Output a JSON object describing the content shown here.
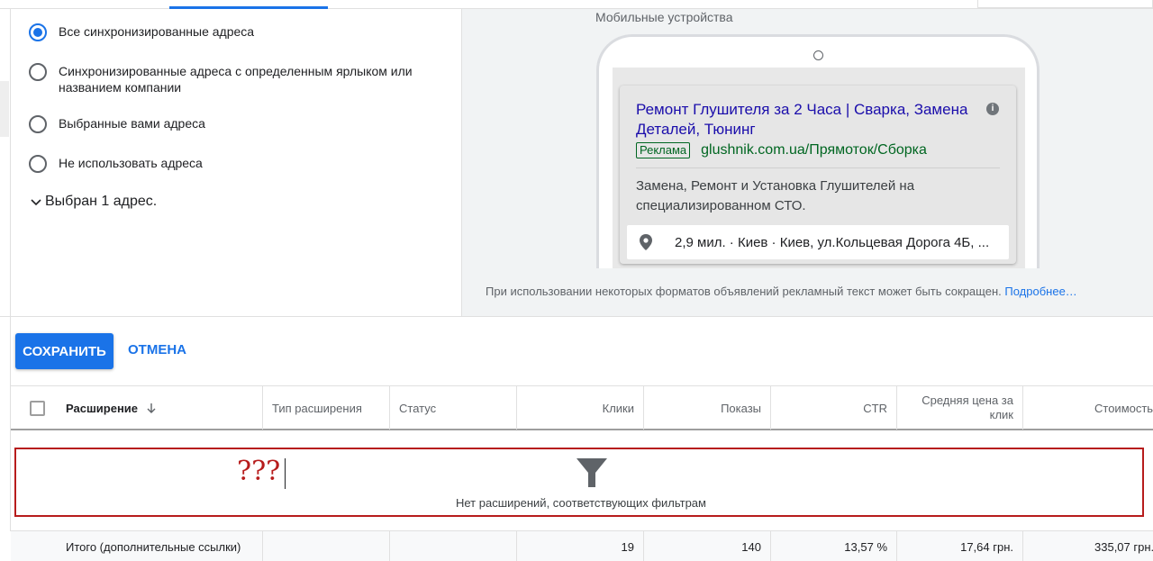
{
  "options": {
    "items": [
      {
        "label": "Все синхронизированные адреса",
        "checked": true
      },
      {
        "label": "Синхронизированные адреса с определенным ярлыком или названием компании",
        "checked": false
      },
      {
        "label": "Выбранные вами адреса",
        "checked": false
      },
      {
        "label": "Не использовать адреса",
        "checked": false
      }
    ],
    "expander_label": "Выбран 1 адрес."
  },
  "preview": {
    "device_label": "Мобильные устройства",
    "ad": {
      "title": "Ремонт Глушителя за 2 Часа | Сварка, Замена Деталей, Тюнинг",
      "badge": "Реклама",
      "url": "glushnik.com.ua/Прямоток/Сборка",
      "description": "Замена, Ремонт и Установка Глушителей на специализированном СТО.",
      "location": "2,9 мил. · Киев · Киев, ул.Кольцевая Дорога 4Б, ..."
    },
    "note": "При использовании некоторых форматов объявлений рекламный текст может быть сокращен.",
    "note_link": "Подробнее…"
  },
  "actions": {
    "save_label": "СОХРАНИТЬ",
    "cancel_label": "ОТМЕНА"
  },
  "table": {
    "headers": {
      "extension": "Расширение",
      "type": "Тип расширения",
      "status": "Статус",
      "clicks": "Клики",
      "impressions": "Показы",
      "ctr": "CTR",
      "avg_cpc": "Средняя цена за клик",
      "cost": "Стоимость"
    },
    "empty_annotation": "???",
    "empty_message": "Нет расширений, соответствующих фильтрам",
    "totals": {
      "label": "Итого (дополнительные ссылки)",
      "clicks": "19",
      "impressions": "140",
      "ctr": "13,57 %",
      "avg_cpc": "17,64 грн.",
      "cost": "335,07 грн."
    }
  },
  "colors": {
    "accent": "#1a73e8",
    "ad_title": "#1a0dab",
    "ad_url": "#006621",
    "annotation": "#b71c1c"
  }
}
